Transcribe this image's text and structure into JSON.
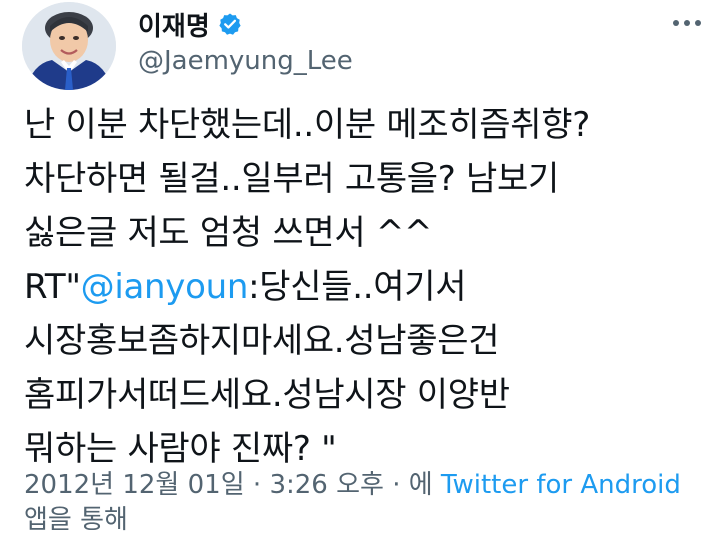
{
  "author": {
    "display_name": "이재명",
    "handle": "@Jaemyung_Lee",
    "verified_icon": "verified-badge-icon",
    "avatar_icon": "profile-photo"
  },
  "tweet": {
    "text_before_mention": "난 이분 차단했는데..이분 메조히즘취향?\n차단하면 될걸..일부러 고통을? 남보기\n싫은글 저도 엄청 쓰면서 ^^\nRT\"",
    "mention": "@ianyoun",
    "text_after_mention": ":당신들..여기서\n시장홍보좀하지마세요.성남좋은건\n홈피가서떠드세요.성남시장 이양반\n뭐하는 사람야 진짜? \""
  },
  "meta": {
    "date": "2012년 12월 01일",
    "sep1": " · ",
    "time": "3:26 오후",
    "sep2": " · ",
    "via_prefix": "에 ",
    "source": "Twitter for Android",
    "via_suffix": "앱을 통해"
  },
  "colors": {
    "link": "#1d9bf0",
    "secondary_text": "#536471",
    "primary_text": "#0f1419",
    "verified": "#1d9bf0"
  },
  "icons": {
    "more": "more-options-icon"
  }
}
